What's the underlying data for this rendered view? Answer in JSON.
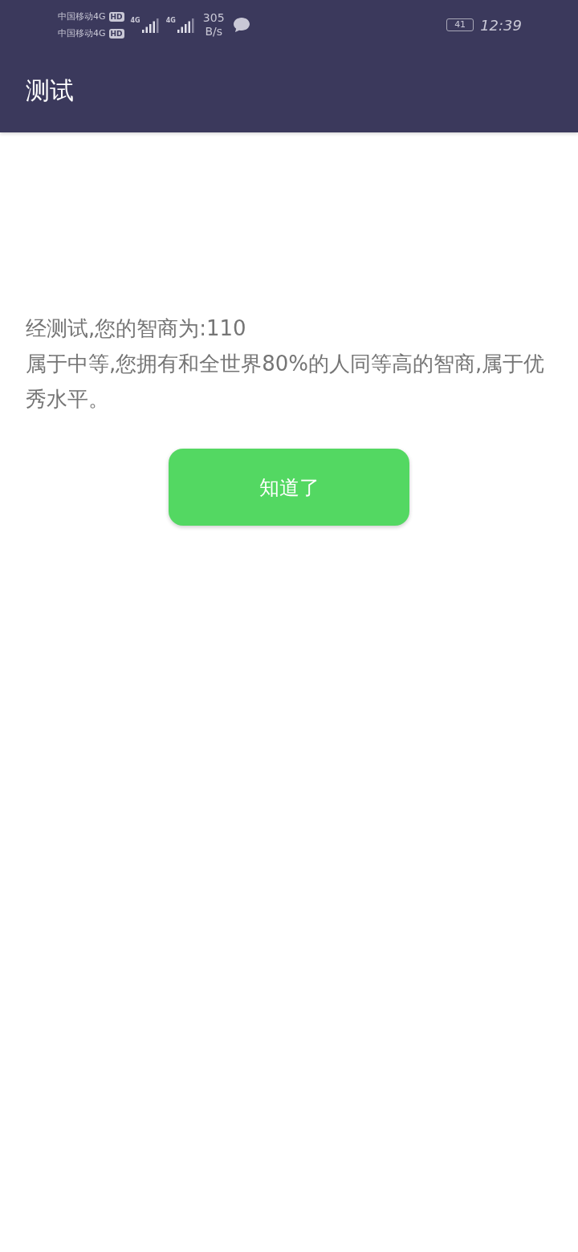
{
  "status_bar": {
    "carriers": [
      {
        "name": "中国移动4G",
        "badge": "HD"
      },
      {
        "name": "中国移动4G",
        "badge": "HD"
      }
    ],
    "signals": [
      {
        "label": "4G"
      },
      {
        "label": "4G"
      }
    ],
    "speed": {
      "value": "305",
      "unit": "B/s"
    },
    "battery": "41",
    "time": "12:39"
  },
  "app_bar": {
    "title": "测试"
  },
  "result": {
    "headline": "经测试,您的智商为:110",
    "description": "属于中等,您拥有和全世界80%的人同等高的智商,属于优秀水平。"
  },
  "button": {
    "label": "知道了"
  }
}
